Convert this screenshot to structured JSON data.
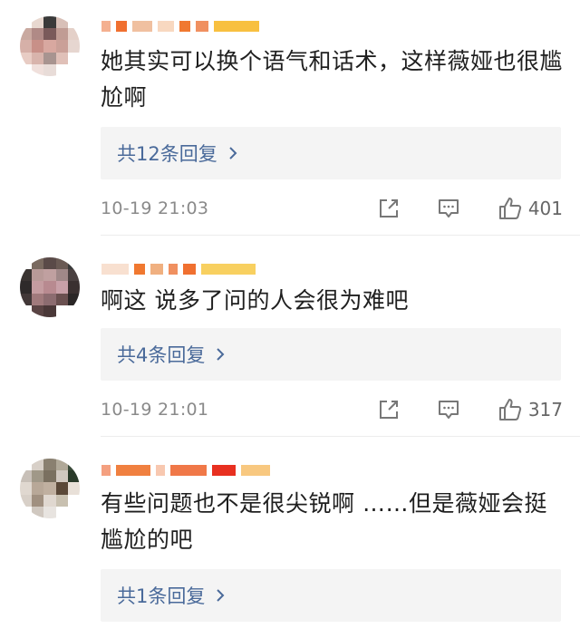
{
  "comments": [
    {
      "text": "她其实可以换个语气和话术，这样薇娅也很尴尬啊",
      "replies_label": "共12条回复",
      "time": "10-19 21:03",
      "likes": "401"
    },
    {
      "text": "啊这 说多了问的人会很为难吧",
      "replies_label": "共4条回复",
      "time": "10-19 21:01",
      "likes": "317"
    },
    {
      "text": "有些问题也不是很尖锐啊 ……但是薇娅会挺尴尬的吧",
      "replies_label": "共1条回复"
    }
  ],
  "icons": {
    "share": "share-icon",
    "comment": "comment-icon",
    "like": "thumbs-up-icon",
    "chevron": "chevron-right-icon"
  },
  "colors": {
    "reply_link": "#4a6a9a",
    "reply_bg": "#f4f4f4",
    "meta_text": "#8a8a8a"
  }
}
